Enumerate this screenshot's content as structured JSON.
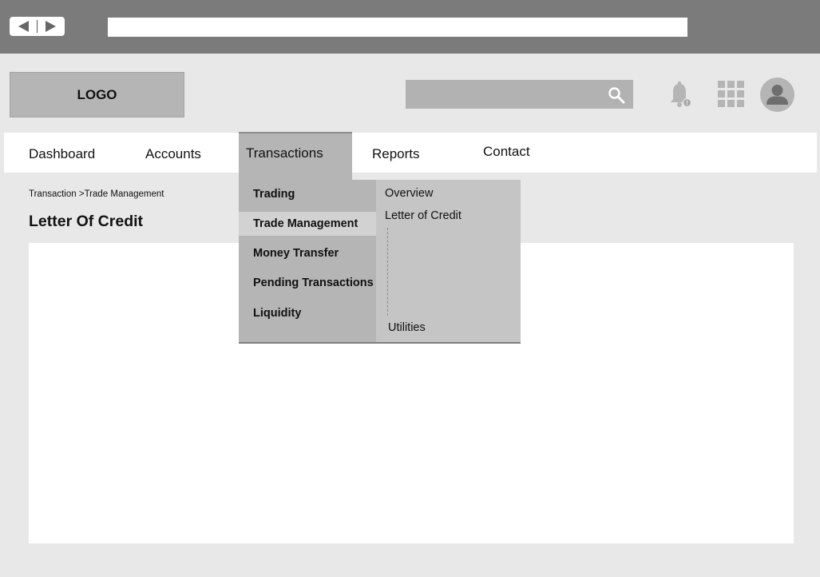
{
  "browser": {
    "back_icon": "triangle-left-icon",
    "forward_icon": "triangle-right-icon",
    "address_value": ""
  },
  "header": {
    "logo_text": "LOGO",
    "search_placeholder": "",
    "icons": [
      "search-icon",
      "bell-icon",
      "apps-grid-icon",
      "user-avatar-icon"
    ]
  },
  "nav": {
    "items": [
      {
        "label": "Dashboard"
      },
      {
        "label": "Accounts"
      },
      {
        "label": "Transactions",
        "active": true
      },
      {
        "label": "Reports"
      },
      {
        "label": "Contact"
      }
    ]
  },
  "dropdown": {
    "items": [
      {
        "label": "Trading"
      },
      {
        "label": "Trade Management",
        "selected": true
      },
      {
        "label": "Money Transfer"
      },
      {
        "label": "Pending Transactions"
      },
      {
        "label": "Liquidity"
      }
    ],
    "submenu": [
      {
        "label": "Overview"
      },
      {
        "label": "Letter of Credit"
      },
      {
        "label": "Utilities"
      }
    ]
  },
  "page": {
    "breadcrumb": "Transaction >Trade Management",
    "title": "Letter Of Credit"
  },
  "colors": {
    "chrome": "#7b7b7b",
    "background": "#e8e8e8",
    "accent_gray": "#b5b5b5",
    "submenu_gray": "#c5c5c5",
    "selected_gray": "#d2d2d2"
  }
}
